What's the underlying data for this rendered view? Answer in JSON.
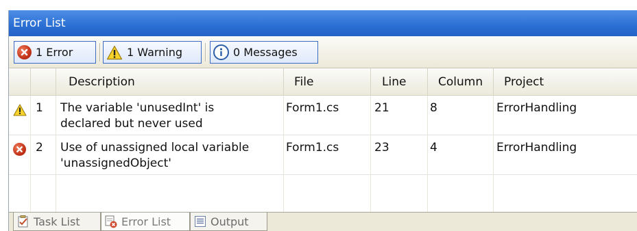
{
  "window": {
    "title": "Error List"
  },
  "toolbar": {
    "errors_label": "1 Error",
    "warnings_label": "1 Warning",
    "messages_label": "0 Messages"
  },
  "columns": {
    "description": "Description",
    "file": "File",
    "line": "Line",
    "column": "Column",
    "project": "Project"
  },
  "rows": [
    {
      "icon": "warning-icon",
      "num": "1",
      "description_line1": "The variable 'unusedInt' is",
      "description_line2": "declared but never used",
      "file": "Form1.cs",
      "line": "21",
      "column": "8",
      "project": "ErrorHandling"
    },
    {
      "icon": "error-icon",
      "num": "2",
      "description_line1": "Use of unassigned local variable",
      "description_line2": "'unassignedObject'",
      "file": "Form1.cs",
      "line": "23",
      "column": "4",
      "project": "ErrorHandling"
    }
  ],
  "tabs": [
    {
      "label": "Task List",
      "icon": "task-list-icon"
    },
    {
      "label": "Error List",
      "icon": "error-list-icon"
    },
    {
      "label": "Output",
      "icon": "output-icon"
    }
  ],
  "colors": {
    "titlebar": "#2a6fd3",
    "error": "#c3341a",
    "warning": "#f4d21f",
    "info": "#2f5ea8"
  }
}
